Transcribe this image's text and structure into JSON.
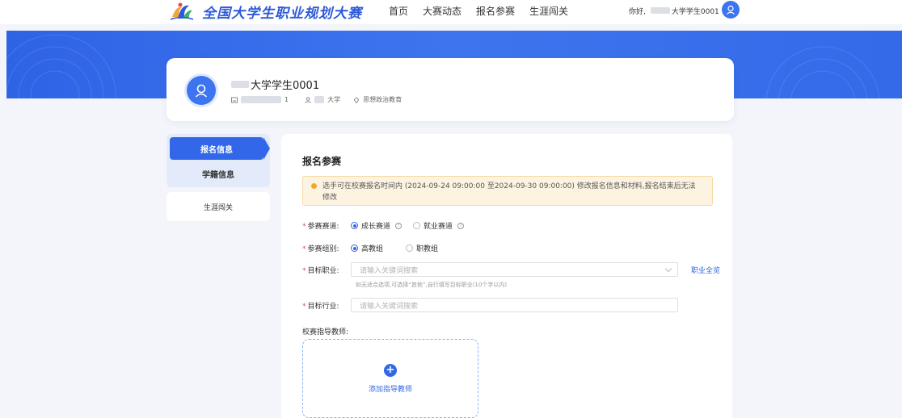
{
  "header": {
    "site_title": "全国大学生职业规划大赛",
    "nav": [
      "首页",
      "大赛动态",
      "报名参赛",
      "生涯闯关"
    ],
    "greeting_prefix": "你好,",
    "greeting_user": "大学学生0001"
  },
  "profile": {
    "name": "大学学生0001",
    "id_suffix": "1",
    "school": "大学",
    "major": "思想政治教育"
  },
  "sidebar": {
    "items": [
      {
        "label": "报名信息",
        "active": true
      },
      {
        "label": "学籍信息",
        "active": false
      },
      {
        "label": "生涯闯关",
        "active": false
      }
    ]
  },
  "form": {
    "section_title": "报名参赛",
    "notice": "选手可在校赛报名时间内 (2024-09-24 09:00:00 至2024-09-30 09:00:00) 修改报名信息和材料,报名结束后无法修改",
    "track": {
      "label": "参赛赛道:",
      "options": [
        "成长赛道",
        "就业赛道"
      ],
      "selected": "成长赛道"
    },
    "group": {
      "label": "参赛组别:",
      "options": [
        "高教组",
        "职教组"
      ],
      "selected": "高教组"
    },
    "target_job": {
      "label": "目标职业:",
      "placeholder": "请输入关键词搜索",
      "link": "职业全览",
      "hint": "如无适合选项,可选择“其他”,自行填写目标职业(10个字以内)"
    },
    "target_industry": {
      "label": "目标行业:",
      "placeholder": "请输入关键词搜索"
    },
    "teacher": {
      "label": "校赛指导教师:",
      "add_label": "添加指导教师"
    }
  },
  "colors": {
    "primary": "#3167e8",
    "banner": "#3469e8",
    "notice_bg": "#fdf3e1",
    "required": "#e84a4a"
  }
}
